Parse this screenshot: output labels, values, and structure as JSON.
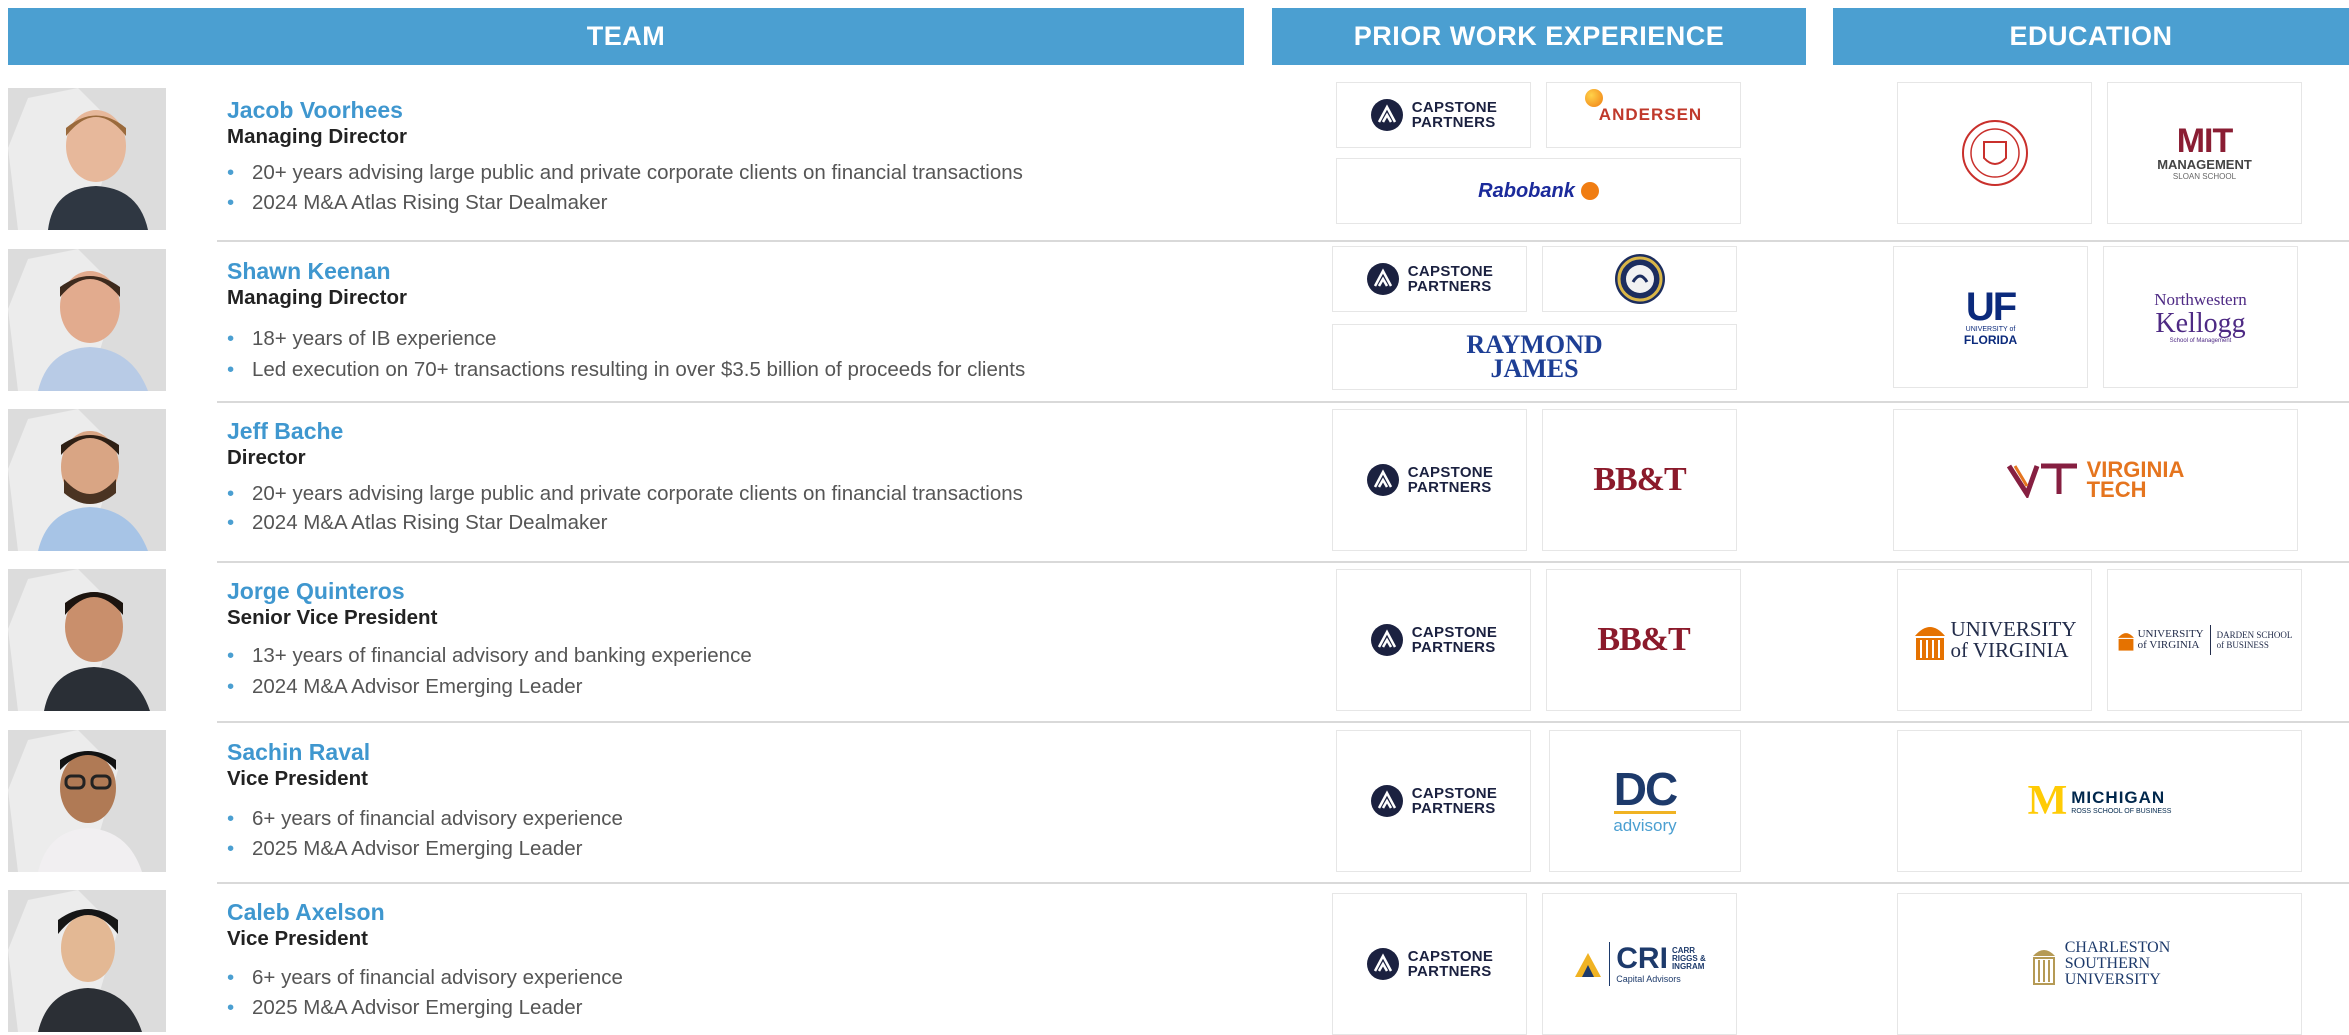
{
  "headers": {
    "team": "TEAM",
    "prior": "PRIOR WORK EXPERIENCE",
    "education": "EDUCATION"
  },
  "colors": {
    "header": "#4b9fd1",
    "name": "#3f97cf",
    "bullet": "#4b9fd1"
  },
  "members": [
    {
      "name": "Jacob Voorhees",
      "title": "Managing Director",
      "bullets": [
        "20+ years advising large public and private corporate clients on financial transactions",
        "2024 M&A Atlas Rising Star Dealmaker"
      ],
      "prior": [
        "CAPSTONE PARTNERS",
        "ANDERSEN",
        "Rabobank"
      ],
      "education": [
        "Cornell University seal",
        "MIT MANAGEMENT SLOAN SCHOOL"
      ]
    },
    {
      "name": "Shawn Keenan",
      "title": "Managing Director",
      "bullets": [
        "18+ years of IB experience",
        "Led execution on 70+ transactions resulting in over $3.5 billion of proceeds for clients"
      ],
      "prior": [
        "CAPSTONE PARTNERS",
        "U.S. Navy seal",
        "RAYMOND JAMES"
      ],
      "education": [
        "UF UNIVERSITY of FLORIDA",
        "Northwestern Kellogg School of Management"
      ]
    },
    {
      "name": "Jeff Bache",
      "title": "Director",
      "bullets": [
        "20+ years advising large public and private corporate clients on financial transactions",
        "2024 M&A Atlas Rising Star Dealmaker"
      ],
      "prior": [
        "CAPSTONE PARTNERS",
        "BB&T"
      ],
      "education": [
        "VIRGINIA TECH"
      ]
    },
    {
      "name": "Jorge Quinteros",
      "title": "Senior Vice President",
      "bullets": [
        "13+ years of financial advisory and banking experience",
        "2024 M&A Advisor Emerging Leader"
      ],
      "prior": [
        "CAPSTONE PARTNERS",
        "BB&T"
      ],
      "education": [
        "UNIVERSITY of VIRGINIA",
        "UNIVERSITY of VIRGINIA DARDEN SCHOOL of BUSINESS"
      ]
    },
    {
      "name": "Sachin Raval",
      "title": "Vice President",
      "bullets": [
        "6+ years of financial advisory experience",
        "2025 M&A Advisor Emerging Leader"
      ],
      "prior": [
        "CAPSTONE PARTNERS",
        "DC advisory"
      ],
      "education": [
        "MICHIGAN ROSS SCHOOL OF BUSINESS"
      ]
    },
    {
      "name": "Caleb Axelson",
      "title": "Vice President",
      "bullets": [
        "6+ years of financial advisory experience",
        "2025 M&A Advisor Emerging Leader"
      ],
      "prior": [
        "CAPSTONE PARTNERS",
        "CRI CARR RIGGS & INGRAM Capital Advisors"
      ],
      "education": [
        "CHARLESTON SOUTHERN UNIVERSITY"
      ]
    }
  ],
  "logo_text": {
    "capstone_1": "CAPSTONE",
    "capstone_2": "PARTNERS",
    "andersen": "ANDERSEN",
    "rabobank": "Rabobank",
    "mit_1": "MIT",
    "mit_2": "MANAGEMENT",
    "mit_3": "SLOAN SCHOOL",
    "rj_1": "RAYMOND",
    "rj_2": "JAMES",
    "uf_1": "UF",
    "uf_2": "UNIVERSITY of",
    "uf_3": "FLORIDA",
    "nw_1": "Northwestern",
    "nw_2": "Kellogg",
    "nw_3": "School of Management",
    "bbt": "BB&T",
    "vt_1": "VIRGINIA",
    "vt_2": "TECH",
    "uva_1": "UNIVERSITY",
    "uva_2": "of VIRGINIA",
    "darden_1": "UNIVERSITY",
    "darden_2": "of VIRGINIA",
    "darden_3": "DARDEN SCHOOL",
    "darden_4": "of BUSINESS",
    "dc_1": "DC",
    "dc_2": "advisory",
    "mich_1": "MICHIGAN",
    "mich_2": "ROSS SCHOOL OF BUSINESS",
    "cri_1": "CRI",
    "cri_2": "CARR",
    "cri_3": "RIGGS &",
    "cri_4": "INGRAM",
    "cri_5": "Capital Advisors",
    "csu_1": "CHARLESTON",
    "csu_2": "SOUTHERN",
    "csu_3": "UNIVERSITY"
  }
}
